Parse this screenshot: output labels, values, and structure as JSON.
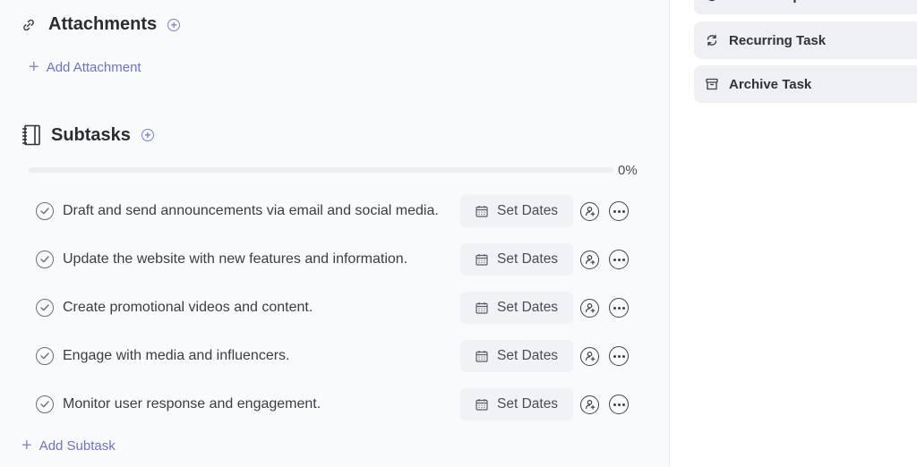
{
  "attachments": {
    "title": "Attachments",
    "add_label": "Add Attachment"
  },
  "subtasks": {
    "title": "Subtasks",
    "progress_percent": 0,
    "progress_label": "0%",
    "items": [
      {
        "text": "Draft and send announcements via email and social media.",
        "dates_label": "Set Dates"
      },
      {
        "text": "Update the website with new features and information.",
        "dates_label": "Set Dates"
      },
      {
        "text": "Create promotional videos and content.",
        "dates_label": "Set Dates"
      },
      {
        "text": "Engage with media and influencers.",
        "dates_label": "Set Dates"
      },
      {
        "text": "Monitor user response and engagement.",
        "dates_label": "Set Dates"
      }
    ],
    "add_label": "Add Subtask"
  },
  "sidebar": {
    "actions": [
      {
        "label": "Make Template",
        "icon": "template-icon"
      },
      {
        "label": "Recurring Task",
        "icon": "refresh-icon"
      },
      {
        "label": "Archive Task",
        "icon": "archive-icon"
      }
    ]
  },
  "colors": {
    "accent": "#7b7fd6",
    "link": "#6f6fd0"
  }
}
